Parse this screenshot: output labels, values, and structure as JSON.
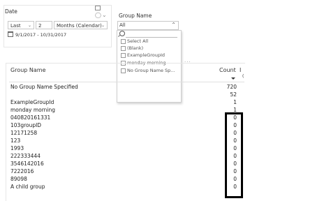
{
  "date_slicer": {
    "title": "Date",
    "relative": "Last",
    "count": "2",
    "unit": "Months (Calendar)",
    "range": "9/1/2017 - 10/31/2017",
    "icons": [
      "focus-mode-icon",
      "eraser-icon",
      "chevron-down-icon",
      "calendar-icon",
      "dropdown-arrow-icon"
    ]
  },
  "group_slicer": {
    "title": "Group Name",
    "selected": "All",
    "search_placeholder": "",
    "options": [
      "Select All",
      "(Blank)",
      "ExampleGroupId",
      "monday morning",
      "No Group Name Sp..."
    ],
    "icons": [
      "chevron-up-icon",
      "search-icon",
      "checkbox-icon"
    ]
  },
  "table": {
    "menu": "...",
    "columns": {
      "group": "Group Name",
      "count": "Count",
      "extra": "I",
      "extra_sub": "("
    },
    "rows": [
      {
        "name": "No Group Name Specified",
        "count": "720"
      },
      {
        "name": "",
        "count": "52"
      },
      {
        "name": "ExampleGroupId",
        "count": "1"
      },
      {
        "name": "monday morning",
        "count": "1"
      },
      {
        "name": "040820161331",
        "count": "0"
      },
      {
        "name": "103groupID",
        "count": "0"
      },
      {
        "name": "12171258",
        "count": "0"
      },
      {
        "name": "123",
        "count": "0"
      },
      {
        "name": "1993",
        "count": "0"
      },
      {
        "name": "222333444",
        "count": "0"
      },
      {
        "name": "3546142016",
        "count": "0"
      },
      {
        "name": "7222016",
        "count": "0"
      },
      {
        "name": "89098",
        "count": "0"
      },
      {
        "name": "A child group",
        "count": "0"
      }
    ],
    "sort": "descending",
    "highlight_color": "#000000"
  }
}
